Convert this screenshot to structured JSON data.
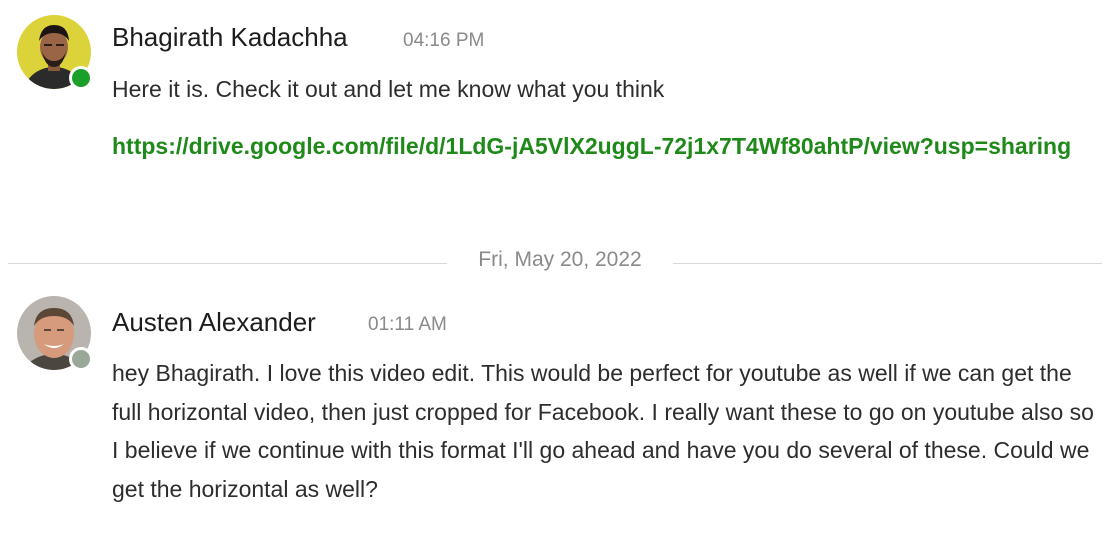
{
  "messages": [
    {
      "author": "Bhagirath Kadachha",
      "time": "04:16 PM",
      "text": "Here it is. Check it out and let me know what you think",
      "link": "https://drive.google.com/file/d/1LdG-jA5VlX2uggL-72j1x7T4Wf80ahtP/view?usp=sharing",
      "presence_color": "#1a9f2b"
    },
    {
      "author": "Austen Alexander",
      "time": "01:11 AM",
      "text": "hey Bhagirath. I love this video edit. This would be perfect for youtube as well if we can get the full horizontal video, then just cropped for Facebook. I really want these to go on youtube also so I believe if we continue with this format I'll go ahead and have you do several of these. Could we get the horizontal as well?",
      "presence_color": "#9aa89a"
    }
  ],
  "date_divider": "Fri, May 20, 2022"
}
